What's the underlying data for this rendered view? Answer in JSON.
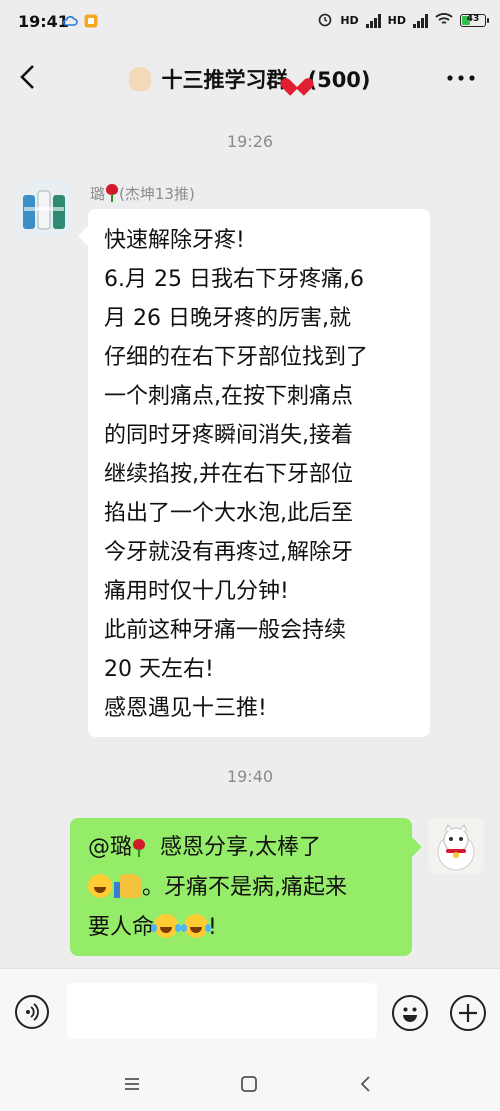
{
  "status_bar": {
    "time": "19:41",
    "battery": "43",
    "battery_level": 0.43,
    "network_1": "HD",
    "network_2": "HD",
    "icons": [
      "cloud-sync-icon",
      "app-notification-icon",
      "alarm-icon",
      "signal-icon",
      "signal-icon",
      "wifi-icon",
      "battery-icon"
    ]
  },
  "header": {
    "title": "十三推学习群",
    "member_count": "(500)",
    "icons": [
      "back-arrow-icon",
      "raised-hand-emoji",
      "red-heart-emoji",
      "more-icon"
    ]
  },
  "messages": [
    {
      "timestamp": "19:26",
      "sender": "璐",
      "sender_suffix": "(杰坤13推)",
      "direction": "incoming",
      "lines": [
        "快速解除牙疼!",
        "6.月 25 日我右下牙疼痛,6",
        "月 26 日晚牙疼的厉害,就",
        "仔细的在右下牙部位找到了",
        "一个刺痛点,在按下刺痛点",
        "的同时牙疼瞬间消失,接着",
        "继续掐按,并在右下牙部位",
        "掐出了一个大水泡,此后至",
        "今牙就没有再疼过,解除牙",
        "痛用时仅十几分钟!",
        "此前这种牙痛一般会持续",
        "20 天左右!",
        "感恩遇见十三推!"
      ]
    },
    {
      "timestamp": "19:40",
      "direction": "outgoing",
      "mention": "@璐",
      "text_1": "感恩分享,太棒了",
      "text_2": "。牙痛不是病,痛起来",
      "text_3": "要人命",
      "text_4": "!"
    }
  ],
  "input_bar": {
    "placeholder": "",
    "icons": [
      "voice-icon",
      "emoji-icon",
      "plus-icon"
    ]
  },
  "nav_bar": {
    "icons": [
      "menu-icon",
      "home-icon",
      "back-icon"
    ]
  },
  "colors": {
    "background": "#ededed",
    "incoming_bubble": "#ffffff",
    "outgoing_bubble": "#95ec69",
    "timestamp_text": "#8a8a8a"
  }
}
